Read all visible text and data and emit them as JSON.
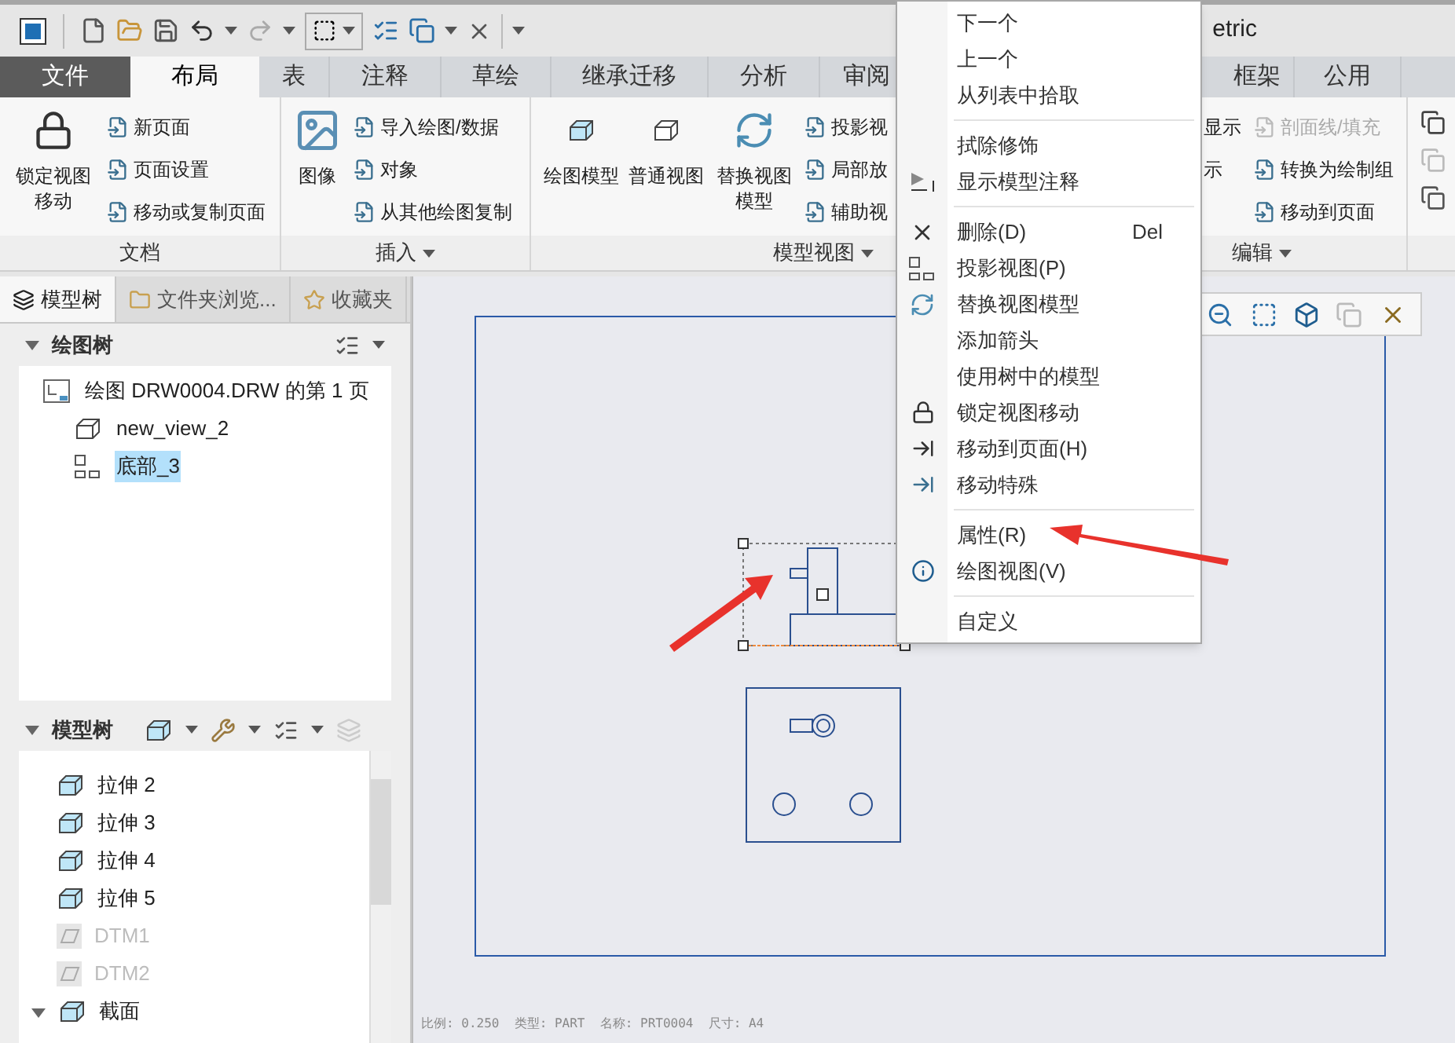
{
  "title_bar": {
    "title": "etric"
  },
  "ribbon_tabs": [
    {
      "label": "文件",
      "kind": "file",
      "selected": false
    },
    {
      "label": "布局",
      "kind": "tab",
      "selected": true
    },
    {
      "label": "表",
      "kind": "tab",
      "selected": false
    },
    {
      "label": "注释",
      "kind": "tab",
      "selected": false
    },
    {
      "label": "草绘",
      "kind": "tab",
      "selected": false
    },
    {
      "label": "继承迁移",
      "kind": "tab",
      "selected": false
    },
    {
      "label": "分析",
      "kind": "tab",
      "selected": false
    },
    {
      "label": "审阅",
      "kind": "tab",
      "selected": false
    },
    {
      "label": "框架",
      "kind": "tab",
      "selected": false
    },
    {
      "label": "公用",
      "kind": "tab",
      "selected": false
    }
  ],
  "ribbon_groups": [
    {
      "label": "文档",
      "dropdown": false,
      "large": [
        {
          "label": "锁定视图移动"
        }
      ],
      "small_columns": [
        [
          {
            "label": "新页面",
            "disabled": false
          },
          {
            "label": "页面设置",
            "disabled": false
          },
          {
            "label": "移动或复制页面",
            "disabled": false
          }
        ]
      ]
    },
    {
      "label": "插入",
      "dropdown": true,
      "large": [
        {
          "label": "图像"
        }
      ],
      "small_columns": [
        [
          {
            "label": "导入绘图/数据",
            "disabled": false
          },
          {
            "label": "对象",
            "disabled": false
          },
          {
            "label": "从其他绘图复制",
            "disabled": false
          }
        ]
      ]
    },
    {
      "label": "模型视图",
      "dropdown": true,
      "large": [
        {
          "label": "绘图模型"
        },
        {
          "label": "普通视图"
        },
        {
          "label": "替换视图模型"
        }
      ],
      "small_columns": [
        [
          {
            "label": "投影视",
            "disabled": false
          },
          {
            "label": "局部放",
            "disabled": false
          },
          {
            "label": "辅助视",
            "disabled": false
          }
        ]
      ]
    },
    {
      "label": "编辑",
      "dropdown": true,
      "small_columns": [
        [
          {
            "label": "显示",
            "disabled": false
          },
          {
            "label": "示",
            "disabled": false
          }
        ],
        [
          {
            "label": "剖面线/填充",
            "disabled": true
          },
          {
            "label": "转换为绘制组",
            "disabled": false
          },
          {
            "label": "移动到页面",
            "disabled": false
          }
        ]
      ]
    }
  ],
  "panel_tabs": [
    {
      "label": "模型树",
      "selected": true
    },
    {
      "label": "文件夹浏览...",
      "selected": false
    },
    {
      "label": "收藏夹",
      "selected": false
    }
  ],
  "drawing_tree": {
    "title": "绘图树",
    "expanded": true,
    "items": [
      {
        "label": "绘图 DRW0004.DRW 的第 1 页",
        "kind": "sheet",
        "selected": false,
        "children": [
          {
            "label": "new_view_2",
            "kind": "view",
            "selected": false
          },
          {
            "label": "底部_3",
            "kind": "projection",
            "selected": true
          }
        ]
      }
    ]
  },
  "model_tree": {
    "title": "模型树",
    "expanded": true,
    "items": [
      {
        "label": "拉伸 2",
        "kind": "extrude",
        "disabled": false
      },
      {
        "label": "拉伸 3",
        "kind": "extrude",
        "disabled": false
      },
      {
        "label": "拉伸 4",
        "kind": "extrude",
        "disabled": false
      },
      {
        "label": "拉伸 5",
        "kind": "extrude",
        "disabled": false
      },
      {
        "label": "DTM1",
        "kind": "datum",
        "disabled": true
      },
      {
        "label": "DTM2",
        "kind": "datum",
        "disabled": true
      },
      {
        "label": "截面",
        "kind": "folder",
        "disabled": false,
        "expanded": true
      }
    ]
  },
  "status_text": "比例: 0.250  类型: PART  名称: PRT0004  尺寸: A4",
  "context_menu": [
    {
      "kind": "item",
      "label": "下一个"
    },
    {
      "kind": "item",
      "label": "上一个"
    },
    {
      "kind": "item",
      "label": "从列表中拾取"
    },
    {
      "kind": "separator"
    },
    {
      "kind": "item",
      "label": "拭除修饰"
    },
    {
      "kind": "item",
      "label": "显示模型注释"
    },
    {
      "kind": "separator"
    },
    {
      "kind": "item",
      "label": "删除(D)",
      "shortcut": "Del"
    },
    {
      "kind": "item",
      "label": "投影视图(P)"
    },
    {
      "kind": "item",
      "label": "替换视图模型"
    },
    {
      "kind": "item",
      "label": "添加箭头"
    },
    {
      "kind": "item",
      "label": "使用树中的模型"
    },
    {
      "kind": "item",
      "label": "锁定视图移动"
    },
    {
      "kind": "item",
      "label": "移动到页面(H)"
    },
    {
      "kind": "item",
      "label": "移动特殊"
    },
    {
      "kind": "separator"
    },
    {
      "kind": "item",
      "label": "属性(R)"
    },
    {
      "kind": "item",
      "label": "绘图视图(V)"
    },
    {
      "kind": "separator"
    },
    {
      "kind": "item",
      "label": "自定义"
    }
  ]
}
